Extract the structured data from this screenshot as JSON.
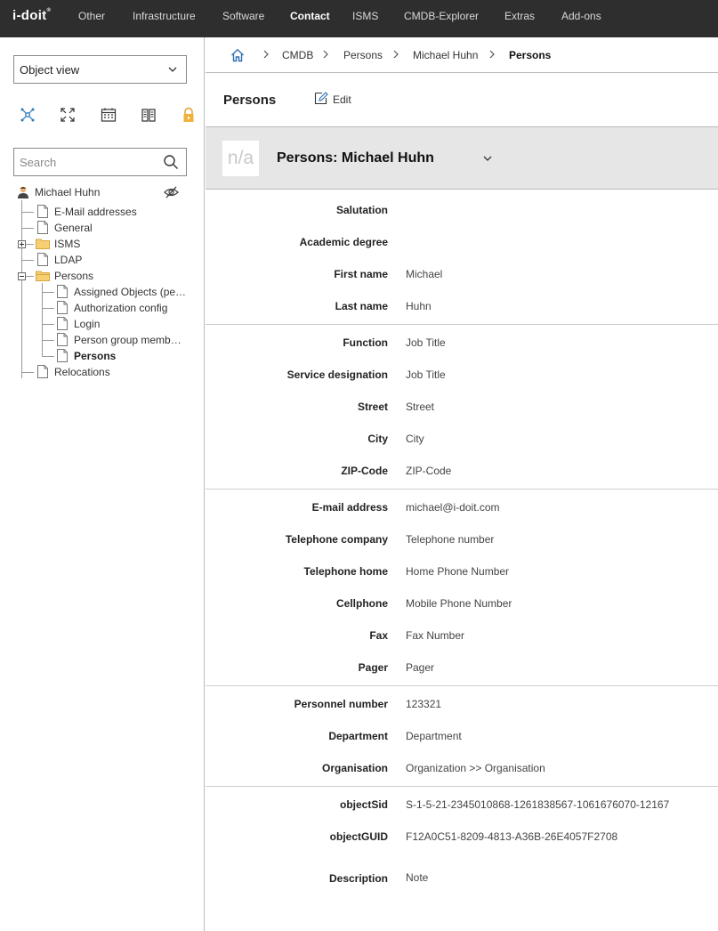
{
  "app": {
    "logo": "i-doit",
    "logo_mark": "®"
  },
  "nav": {
    "items": [
      {
        "label": "Other",
        "active": false
      },
      {
        "label": "Infrastructure",
        "active": false
      },
      {
        "label": "Software",
        "active": false
      },
      {
        "label": "Contact",
        "active": true
      },
      {
        "label": "ISMS",
        "active": false
      },
      {
        "label": "CMDB-Explorer",
        "active": false
      },
      {
        "label": "Extras",
        "active": false
      },
      {
        "label": "Add-ons",
        "active": false
      }
    ]
  },
  "left": {
    "view_select": "Object view",
    "toolbar_icons": [
      "network-icon",
      "fullscreen-icon",
      "calendar-icon",
      "book-icon",
      "lock-icon"
    ],
    "search_placeholder": "Search",
    "tree": {
      "root": "Michael Huhn",
      "items": [
        {
          "label": "E-Mail addresses",
          "type": "file"
        },
        {
          "label": "General",
          "type": "file"
        },
        {
          "label": "ISMS",
          "type": "folder",
          "expanded": false
        },
        {
          "label": "LDAP",
          "type": "file"
        },
        {
          "label": "Persons",
          "type": "folder",
          "expanded": true
        },
        {
          "label": "Assigned Objects (pe…",
          "type": "file"
        },
        {
          "label": "Authorization config",
          "type": "file"
        },
        {
          "label": "Login",
          "type": "file"
        },
        {
          "label": "Person group memb…",
          "type": "file"
        },
        {
          "label": "Persons",
          "type": "file",
          "selected": true
        },
        {
          "label": "Relocations",
          "type": "file"
        }
      ]
    }
  },
  "breadcrumb": [
    "CMDB",
    "Persons",
    "Michael Huhn",
    "Persons"
  ],
  "header": {
    "title": "Persons",
    "edit_label": "Edit"
  },
  "object": {
    "image_placeholder": "n/a",
    "title": "Persons: Michael Huhn"
  },
  "fields": {
    "salutation": {
      "label": "Salutation",
      "value": ""
    },
    "academic_degree": {
      "label": "Academic degree",
      "value": ""
    },
    "first_name": {
      "label": "First name",
      "value": "Michael"
    },
    "last_name": {
      "label": "Last name",
      "value": "Huhn"
    },
    "function": {
      "label": "Function",
      "value": "Job Title"
    },
    "service_designation": {
      "label": "Service designation",
      "value": "Job Title"
    },
    "street": {
      "label": "Street",
      "value": "Street"
    },
    "city": {
      "label": "City",
      "value": "City"
    },
    "zip": {
      "label": "ZIP-Code",
      "value": "ZIP-Code"
    },
    "email": {
      "label": "E-mail address",
      "value": "michael@i-doit.com"
    },
    "telephone_company": {
      "label": "Telephone company",
      "value": "Telephone number"
    },
    "telephone_home": {
      "label": "Telephone home",
      "value": "Home Phone Number"
    },
    "cellphone": {
      "label": "Cellphone",
      "value": "Mobile Phone Number"
    },
    "fax": {
      "label": "Fax",
      "value": "Fax Number"
    },
    "pager": {
      "label": "Pager",
      "value": "Pager"
    },
    "personnel_number": {
      "label": "Personnel number",
      "value": "123321"
    },
    "department": {
      "label": "Department",
      "value": "Department"
    },
    "organisation": {
      "label": "Organisation",
      "value": "Organization >> Organisation"
    },
    "object_sid": {
      "label": "objectSid",
      "value": "S-1-5-21-2345010868-1261838567-1061676070-12167"
    },
    "object_guid": {
      "label": "objectGUID",
      "value": "F12A0C51-8209-4813-A36B-26E4057F2708"
    },
    "description": {
      "label": "Description",
      "value": "Note"
    }
  }
}
